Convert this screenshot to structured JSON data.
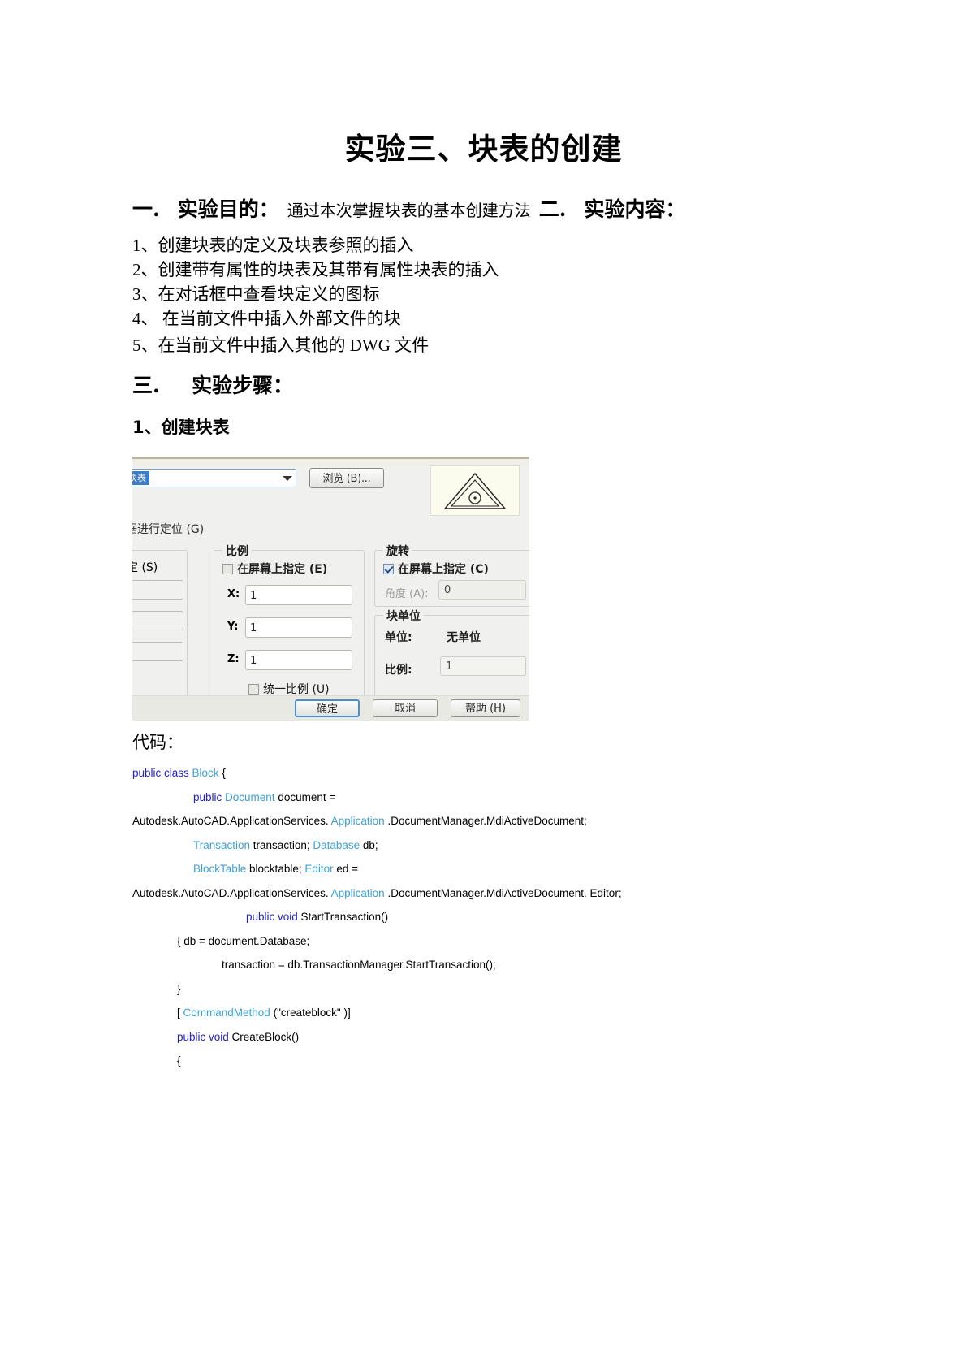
{
  "document": {
    "title": "实验三、块表的创建",
    "section_one": {
      "number": "一.",
      "title": "实验目的：",
      "description": "通过本次掌握块表的基本创建方法"
    },
    "section_two": {
      "number": "二.",
      "title": "实验内容："
    },
    "content_items": [
      "1、创建块表的定义及块表参照的插入",
      "2、创建带有属性的块表及其带有属性块表的插入",
      "3、在对话框中查看块定义的图标",
      "4、  在当前文件中插入外部文件的块",
      "5、在当前文件中插入其他的 DWG 文件"
    ],
    "section_three": {
      "number": "三.",
      "title": "实验步骤："
    },
    "step_one_heading": "1、创建块表",
    "code_heading": "代码："
  },
  "figure": {
    "combo_selected_text": "块表",
    "browse_button": "浏览 (B)...",
    "locate_label": "据进行定位 (G)",
    "left_group": {
      "label": "定 (S)"
    },
    "scale_group": {
      "title": "比例",
      "onscreen_checkbox": "在屏幕上指定 (E)",
      "onscreen_checked": false,
      "axes": [
        {
          "label": "X:",
          "value": "1"
        },
        {
          "label": "Y:",
          "value": "1"
        },
        {
          "label": "Z:",
          "value": "1"
        }
      ],
      "uniform_checkbox": "统一比例 (U)",
      "uniform_checked": false
    },
    "rotation_group": {
      "title": "旋转",
      "onscreen_checkbox": "在屏幕上指定 (C)",
      "onscreen_checked": true,
      "angle_label": "角度 (A):",
      "angle_value": "0"
    },
    "block_unit_group": {
      "title": "块单位",
      "unit_label": "单位:",
      "unit_value": "无单位",
      "scale_label": "比例:",
      "scale_value": "1"
    },
    "buttons": {
      "ok": "确定",
      "cancel": "取消",
      "help": "帮助 (H)"
    },
    "colors": {
      "dialog_bg": "#f0f0ee",
      "preview_bg": "#fbfbee",
      "selection_blue": "#3d7cc9",
      "primary_border": "#4a8ed0"
    }
  },
  "code": {
    "colors": {
      "keyword": "#2222cc",
      "type": "#3da0d6",
      "plain": "#000000"
    },
    "lines": [
      {
        "indent": 0,
        "tokens": [
          {
            "t": "public class ",
            "c": "kw"
          },
          {
            "t": "Block ",
            "c": "typ"
          },
          {
            "t": "{",
            "c": "plain"
          }
        ]
      },
      {
        "indent": 75,
        "tokens": [
          {
            "t": "public ",
            "c": "kw"
          },
          {
            "t": "Document ",
            "c": "typ"
          },
          {
            "t": "document =",
            "c": "plain"
          }
        ]
      },
      {
        "indent": 0,
        "tokens": [
          {
            "t": "Autodesk.AutoCAD.ApplicationServices. ",
            "c": "plain"
          },
          {
            "t": "Application",
            "c": "typ"
          },
          {
            "t": " .DocumentManager.MdiActiveDocument;",
            "c": "plain"
          }
        ]
      },
      {
        "indent": 75,
        "tokens": [
          {
            "t": "Transaction ",
            "c": "typ"
          },
          {
            "t": "transaction; ",
            "c": "plain"
          },
          {
            "t": "Database ",
            "c": "typ"
          },
          {
            "t": "db;",
            "c": "plain"
          }
        ]
      },
      {
        "indent": 75,
        "tokens": [
          {
            "t": "BlockTable ",
            "c": "typ"
          },
          {
            "t": "blocktable; ",
            "c": "plain"
          },
          {
            "t": "Editor ",
            "c": "typ"
          },
          {
            "t": "ed =",
            "c": "plain"
          }
        ]
      },
      {
        "indent": 0,
        "tokens": [
          {
            "t": "Autodesk.AutoCAD.ApplicationServices. ",
            "c": "plain"
          },
          {
            "t": "Application",
            "c": "typ"
          },
          {
            "t": " .DocumentManager.MdiActiveDocument. Editor;",
            "c": "plain"
          }
        ]
      },
      {
        "indent": 140,
        "tokens": [
          {
            "t": "public void ",
            "c": "kw"
          },
          {
            "t": "StartTransaction()",
            "c": "plain"
          }
        ]
      },
      {
        "indent": 55,
        "tokens": [
          {
            "t": "{ db = document.Database;",
            "c": "plain"
          }
        ]
      },
      {
        "indent": 110,
        "tokens": [
          {
            "t": "transaction = db.TransactionManager.StartTransaction();",
            "c": "plain"
          }
        ]
      },
      {
        "indent": 55,
        "tokens": [
          {
            "t": "}",
            "c": "plain"
          }
        ]
      },
      {
        "indent": 55,
        "tokens": [
          {
            "t": "[ ",
            "c": "plain"
          },
          {
            "t": "CommandMethod ",
            "c": "typ"
          },
          {
            "t": "(\"createblock\" )]",
            "c": "plain"
          }
        ]
      },
      {
        "indent": 55,
        "tokens": [
          {
            "t": "public void ",
            "c": "kw"
          },
          {
            "t": "CreateBlock()",
            "c": "plain"
          }
        ]
      },
      {
        "indent": 55,
        "tokens": [
          {
            "t": "{",
            "c": "plain"
          }
        ]
      }
    ]
  }
}
